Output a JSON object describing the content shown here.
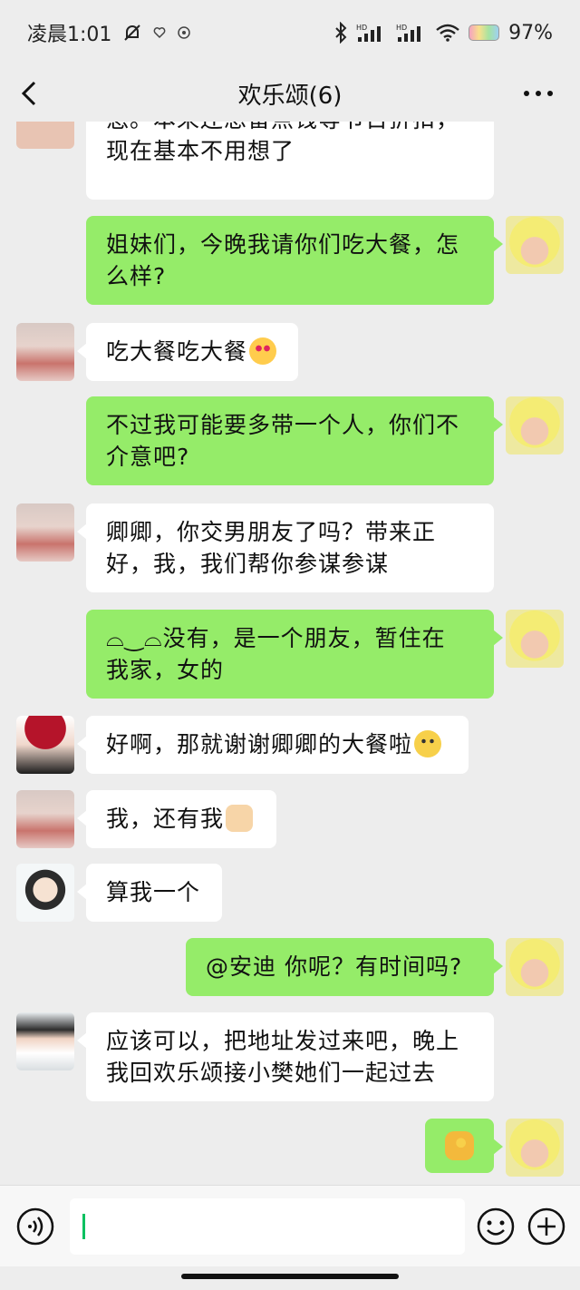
{
  "status_bar": {
    "time": "凌晨1:01",
    "network_badge": "HD",
    "battery_percent": "97%"
  },
  "header": {
    "title": "欢乐颂(6)"
  },
  "messages": [
    {
      "side": "left",
      "text": "悠。本来还想留点钱等节日折扣，\n现在基本不用想了",
      "avatar": "avatar-red-hair"
    },
    {
      "side": "right",
      "text": "姐妹们，今晚我请你们吃大餐，怎\n么样?",
      "avatar": "avatar-yellow-hat"
    },
    {
      "side": "left",
      "text": "吃大餐吃大餐",
      "emoji": "heart-eyes-emoji",
      "avatar": "avatar-pink-bow"
    },
    {
      "side": "right",
      "text": "不过我可能要多带一个人，你们不\n介意吧?",
      "avatar": "avatar-yellow-hat"
    },
    {
      "side": "left",
      "text": "卿卿，你交男朋友了吗？带来正\n好，我，我们帮你参谋参谋",
      "avatar": "avatar-pink-bow"
    },
    {
      "side": "right",
      "text": "⌓‿⌓没有，是一个朋友，暂住在\n我家，女的",
      "avatar": "avatar-yellow-hat"
    },
    {
      "side": "left",
      "text": "好啊，那就谢谢卿卿的大餐啦",
      "emoji": "smile-emoji",
      "avatar": "avatar-red-beret"
    },
    {
      "side": "left",
      "text": "我，还有我",
      "emoji": "raised-hands-emoji",
      "avatar": "avatar-pink-bow"
    },
    {
      "side": "left",
      "text": "算我一个",
      "avatar": "avatar-cartoon-glasses"
    },
    {
      "side": "right",
      "text": "@安迪 你呢？有时间吗?",
      "avatar": "avatar-yellow-hat"
    },
    {
      "side": "left",
      "text": "应该可以，把地址发过来吧，晚上\n我回欢乐颂接小樊她们一起过去",
      "avatar": "avatar-short-hair"
    },
    {
      "side": "right",
      "text": "",
      "emoji": "ok-hand-emoji",
      "avatar": "avatar-yellow-hat"
    }
  ],
  "input_bar": {
    "text_value": ""
  },
  "colors": {
    "sent_bubble": "#95ec69",
    "received_bubble": "#ffffff",
    "background": "#ededed"
  }
}
